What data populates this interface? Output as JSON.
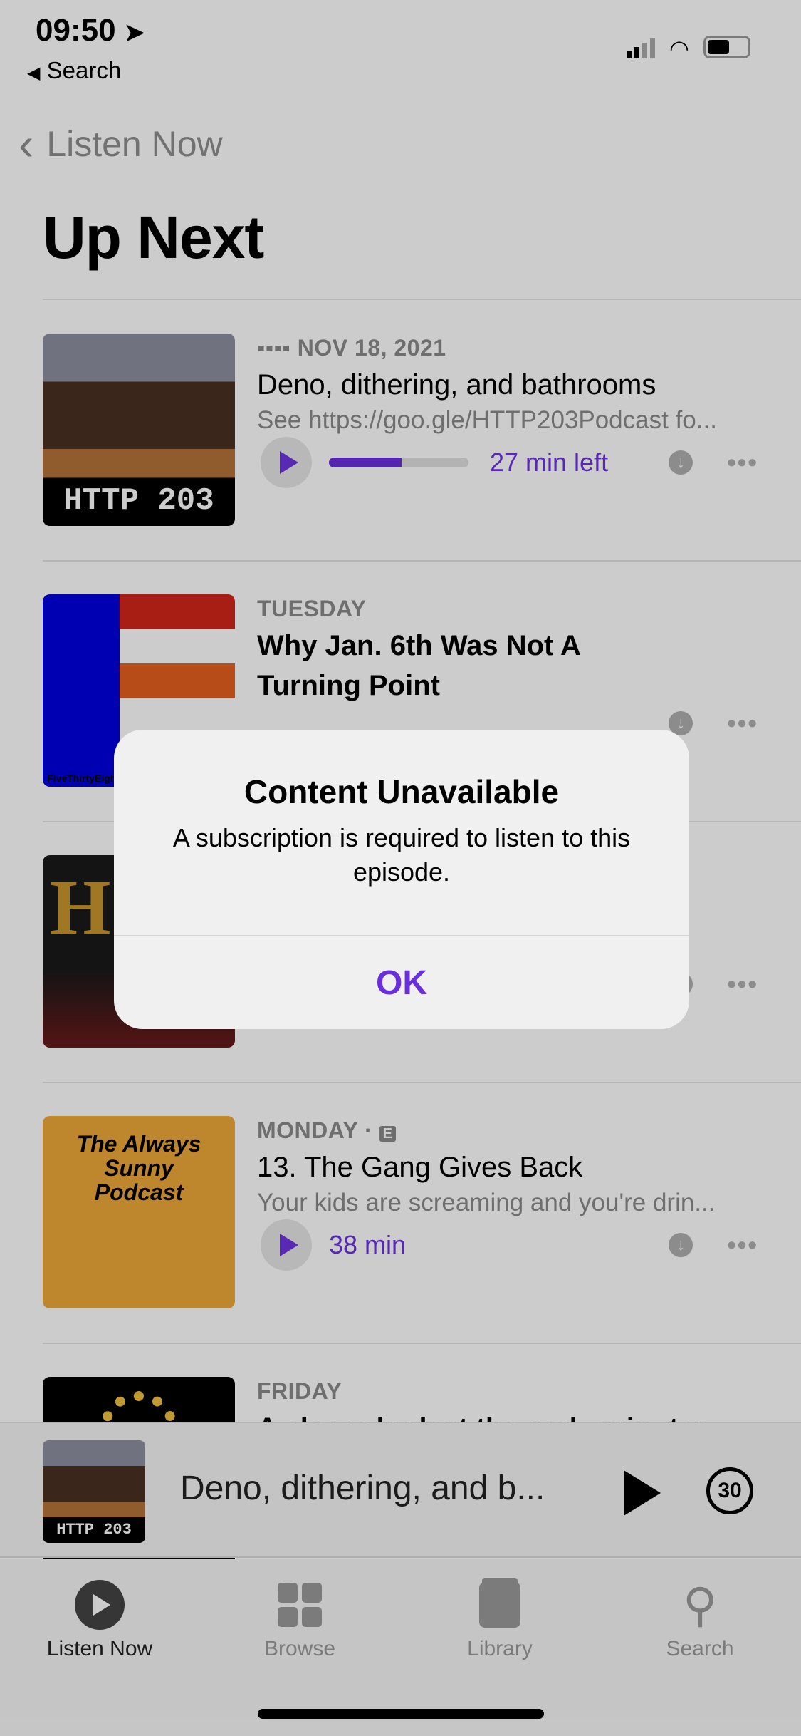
{
  "status_bar": {
    "time": "09:50",
    "back_app": "Search"
  },
  "nav": {
    "back_label": "Listen Now"
  },
  "page_title": "Up Next",
  "episodes": [
    {
      "meta": "NOV 18, 2021",
      "title": "Deno, dithering, and bathrooms",
      "description": "See https://goo.gle/HTTP203Podcast fo...",
      "time": "27 min left",
      "progress": 0.52,
      "art_text": "HTTP 203"
    },
    {
      "meta": "TUESDAY",
      "title": "Why Jan. 6th Was Not A Turning Point",
      "art_text": "FiveThirtyEight"
    },
    {
      "art_text": "H"
    },
    {
      "meta": "MONDAY",
      "explicit": "E",
      "title": "13. The Gang Gives Back",
      "description": "Your kids are screaming and you're drin...",
      "time": "38 min",
      "art_text": "The Always Sunny Podcast"
    },
    {
      "meta": "FRIDAY",
      "title": "A closer look at the early minutes"
    }
  ],
  "mini_player": {
    "title": "Deno, dithering, and b...",
    "art_text": "HTTP 203",
    "skip_label": "30"
  },
  "tabs": [
    {
      "label": "Listen Now",
      "active": true
    },
    {
      "label": "Browse"
    },
    {
      "label": "Library"
    },
    {
      "label": "Search"
    }
  ],
  "alert": {
    "title": "Content Unavailable",
    "message": "A subscription is required to listen to this episode.",
    "ok": "OK"
  },
  "colors": {
    "accent": "#6a2fdc"
  }
}
